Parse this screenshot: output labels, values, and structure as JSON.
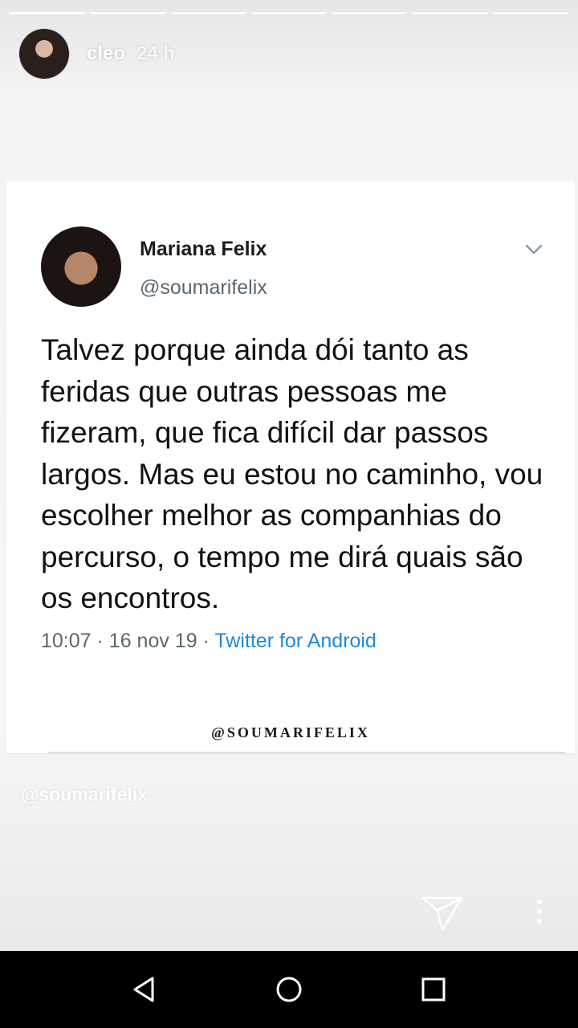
{
  "story": {
    "progress_segments": 7,
    "active_segment": 0,
    "username": "cleo",
    "time_ago": "24 h",
    "mention_tag": "@soumarifelix"
  },
  "tweet": {
    "author_name": "Mariana Felix",
    "author_handle": "@soumarifelix",
    "text": "Talvez porque ainda dói tanto as feridas que outras pessoas me fizeram, que fica difícil dar passos largos. Mas eu estou no caminho, vou escolher melhor as companhias do percurso, o tempo me dirá quais são os encontros.",
    "time": "10:07",
    "date": "16 nov 19",
    "separator": "·",
    "source": "Twitter for Android",
    "watermark": "@SOUMARIFELIX"
  },
  "icons": {
    "send": "paper-plane-icon",
    "more": "more-vertical-icon",
    "chevron": "chevron-down-icon",
    "nav_back": "back-triangle-icon",
    "nav_home": "home-circle-icon",
    "nav_recents": "recents-square-icon"
  },
  "colors": {
    "link": "#1f8ad6",
    "secondary_text": "#5c6770",
    "navbar": "#000000"
  }
}
